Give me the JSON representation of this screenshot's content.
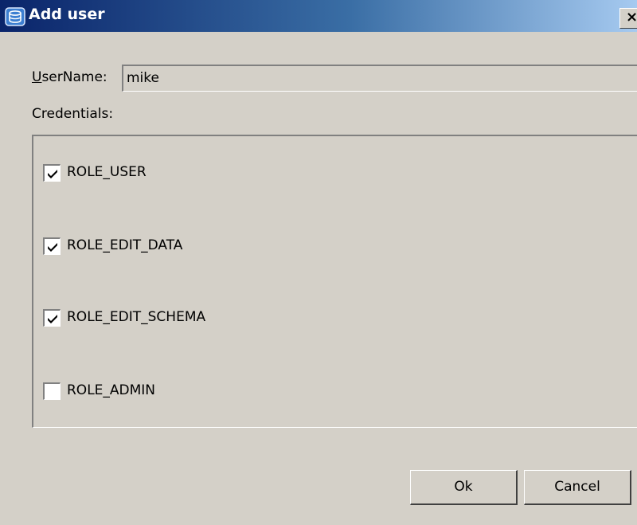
{
  "window": {
    "title": "Add user",
    "close_glyph": "×",
    "icon": "app-icon"
  },
  "form": {
    "username_label_mnemonic": "U",
    "username_label_rest": "serName:",
    "username_value": "mike",
    "credentials_label": "Credentials:"
  },
  "roles": [
    {
      "label": "ROLE_USER",
      "checked": true
    },
    {
      "label": "ROLE_EDIT_DATA",
      "checked": true
    },
    {
      "label": "ROLE_EDIT_SCHEMA",
      "checked": true
    },
    {
      "label": "ROLE_ADMIN",
      "checked": false
    }
  ],
  "buttons": {
    "ok": "Ok",
    "cancel": "Cancel"
  }
}
